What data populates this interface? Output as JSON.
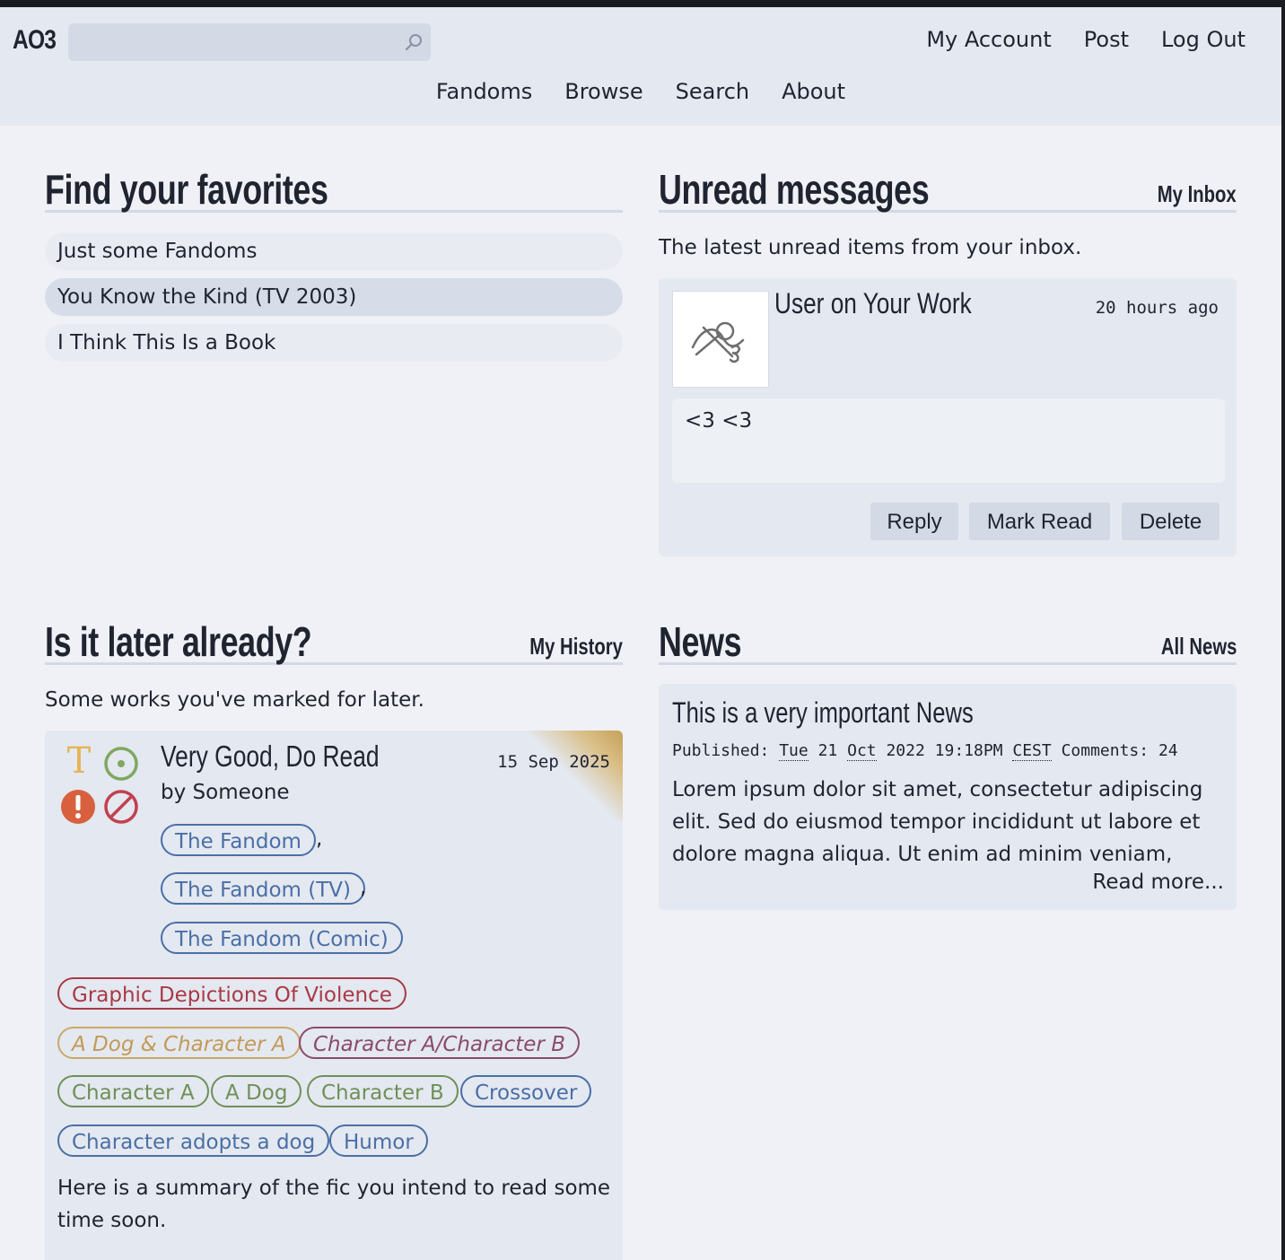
{
  "header": {
    "logo": "AO3",
    "search": {
      "value": "",
      "placeholder": ""
    },
    "user_nav": [
      "My Account",
      "Post",
      "Log Out"
    ],
    "main_nav": [
      "Fandoms",
      "Browse",
      "Search",
      "About"
    ]
  },
  "favorites": {
    "title": "Find your favorites",
    "items": [
      "Just some Fandoms",
      "You Know the Kind (TV 2003)",
      "I Think This Is a Book"
    ]
  },
  "inbox": {
    "title": "Unread messages",
    "link": "My Inbox",
    "intro": "The latest unread items from your inbox.",
    "message": {
      "user": "User",
      "on": "on",
      "work": "Your Work",
      "time": "20 hours ago",
      "body": "<3 <3"
    },
    "buttons": [
      "Reply",
      "Mark Read",
      "Delete"
    ]
  },
  "later": {
    "title": "Is it later already?",
    "link": "My History",
    "intro": "Some works you've marked for later.",
    "work": {
      "title": "Very Good, Do Read",
      "date": "15 Sep 2025",
      "by": "by",
      "author": "Someone",
      "rating_symbol": "T",
      "fandoms": [
        "The Fandom",
        "The Fandom (TV)",
        "The Fandom (Comic)"
      ],
      "warnings": [
        "Graphic Depictions Of Violence"
      ],
      "relationships": [
        "A Dog & Character A",
        "Character A/Character B"
      ],
      "characters": [
        "Character A",
        "A Dog",
        "Character B"
      ],
      "freeforms": [
        "Crossover",
        "Character adopts a dog",
        "Humor"
      ],
      "summary": "Here is a summary of the fic you intend to read some time soon."
    }
  },
  "news": {
    "title": "News",
    "link": "All News",
    "item": {
      "title": "This is a very important News",
      "published_label": "Published:",
      "published_day": "Tue",
      "published_date": "21",
      "published_month": "Oct",
      "published_rest": "2022 19:18PM",
      "published_tz": "CEST",
      "comments_label": "Comments:",
      "comments": "24",
      "body": "Lorem ipsum dolor sit amet, consectetur adipiscing elit. Sed do eiusmod tempor incididunt ut labore et dolore magna aliqua. Ut enim ad minim veniam,",
      "read_more": "Read more..."
    }
  },
  "colors": {
    "header_bg": "#e4e8f0",
    "page_bg": "#eff1f6",
    "card_bg": "#e4e8f0",
    "tag_fandom": "#4a6fa6",
    "tag_warning": "#a83a44",
    "tag_relationship_romantic": "#c29a56",
    "tag_relationship_slash": "#8a4b6c",
    "tag_character": "#6f9058",
    "rating": "#e6b457",
    "category": "#7fa860",
    "warning_icon": "#d9603e",
    "no_warning_icon": "#c2404f"
  }
}
